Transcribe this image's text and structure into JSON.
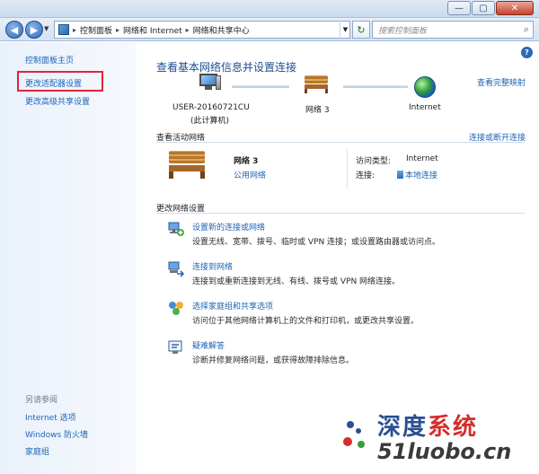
{
  "window": {
    "minimize_glyph": "—",
    "maximize_glyph": "▢",
    "close_glyph": "✕"
  },
  "address_bar": {
    "back_glyph": "◀",
    "forward_glyph": "▶",
    "breadcrumbs": [
      "控制面板",
      "网络和 Internet",
      "网络和共享中心"
    ],
    "separator": "▸",
    "refresh_glyph": "↻",
    "search_placeholder": "搜索控制面板"
  },
  "sidebar": {
    "items": [
      "控制面板主页",
      "更改适配器设置",
      "更改高级共享设置"
    ],
    "see_also_heading": "另请参阅",
    "see_also_items": [
      "Internet 选项",
      "Windows 防火墙",
      "家庭组"
    ],
    "highlight_color": "#e0243a"
  },
  "main": {
    "title": "查看基本网络信息并设置连接",
    "map_link": "查看完整映射",
    "nodes": {
      "computer_name": "USER-20160721CU",
      "computer_sub": "(此计算机)",
      "network": "网络  3",
      "internet": "Internet"
    },
    "active_networks": {
      "label": "查看活动网络",
      "connect_link": "连接或断开连接",
      "network_name": "网络  3",
      "network_type": "公用网络",
      "access_label": "访问类型:",
      "access_value": "Internet",
      "connection_label": "连接:",
      "connection_value": "本地连接"
    },
    "change_settings": {
      "label": "更改网络设置",
      "tasks": [
        {
          "icon": "new-connection-icon",
          "title": "设置新的连接或网络",
          "desc": "设置无线、宽带、拨号、临时或 VPN 连接；或设置路由器或访问点。"
        },
        {
          "icon": "connect-network-icon",
          "title": "连接到网络",
          "desc": "连接到或重新连接到无线、有线、拨号或 VPN 网络连接。"
        },
        {
          "icon": "homegroup-icon",
          "title": "选择家庭组和共享选项",
          "desc": "访问位于其他网络计算机上的文件和打印机，或更改共享设置。"
        },
        {
          "icon": "troubleshoot-icon",
          "title": "疑难解答",
          "desc": "诊断并修复网络问题，或获得故障排除信息。"
        }
      ]
    }
  },
  "watermark": {
    "line1_a": "深度",
    "line1_b": "系统",
    "line2": "51luobo.cn"
  },
  "colors": {
    "link": "#1f64b4",
    "title": "#1d4f91",
    "sidebar_text": "#1f3f66"
  }
}
